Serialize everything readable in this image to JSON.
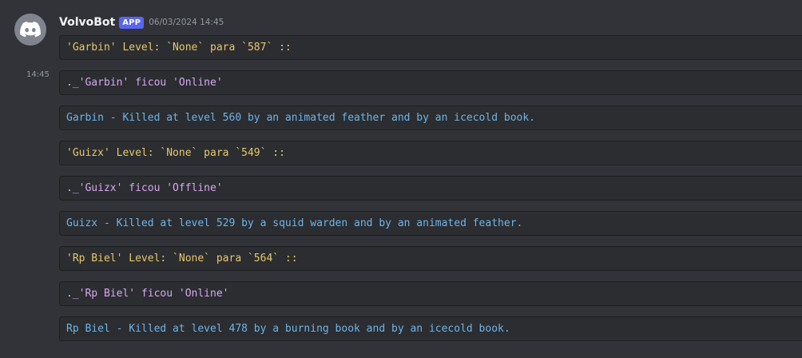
{
  "message": {
    "author": "VolvoBot",
    "badge": "APP",
    "timestamp": "06/03/2024 14:45",
    "side_time": "14:45",
    "lines": [
      "'Garbin' Level: `None` para `587` ::",
      "._'Garbin' ficou 'Online'",
      "Garbin - Killed at level 560 by an animated feather and by an icecold book.",
      "'Guizx' Level: `None` para `549` ::",
      "._'Guizx' ficou 'Offline'",
      "Guizx - Killed at level 529 by a squid warden and by an animated feather.",
      "'Rp Biel' Level: `None` para `564` ::",
      "._'Rp Biel' ficou 'Online'",
      "Rp Biel - Killed at level 478 by a burning book and by an icecold book."
    ]
  },
  "avatar_icon": "discord-logo-icon",
  "colors": {
    "background": "#313338",
    "code_block": "#2b2d31",
    "badge": "#5865f2",
    "level_text": "#e6c86a",
    "status_text": "#d8a8f0",
    "death_text": "#6fb4e8"
  }
}
